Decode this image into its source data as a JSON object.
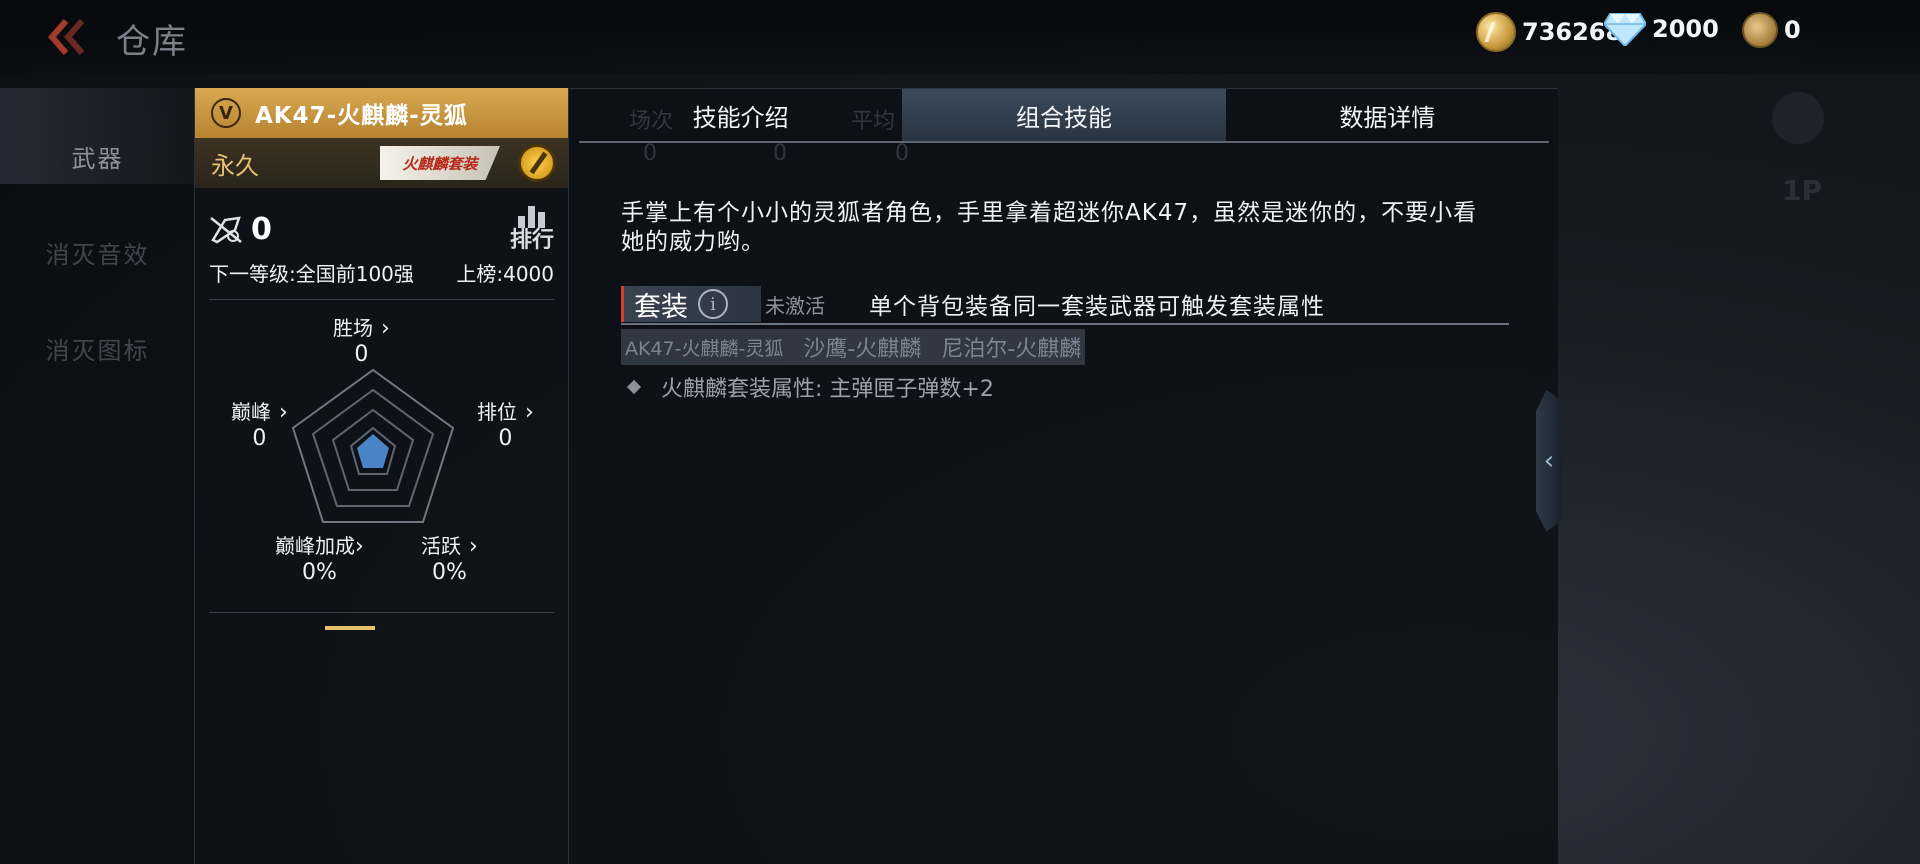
{
  "header": {
    "title": "仓库",
    "currencies": [
      {
        "name": "gold-coin",
        "value": "736268"
      },
      {
        "name": "diamond",
        "value": "2000"
      },
      {
        "name": "honor-coin",
        "value": "0"
      }
    ]
  },
  "side_nav": {
    "items": [
      {
        "label": "武器",
        "active": true
      },
      {
        "label": "消灭音效",
        "active": false
      },
      {
        "label": "消灭图标",
        "active": false
      }
    ]
  },
  "weapon": {
    "badge": "V",
    "name": "AK47-火麒麟-灵狐",
    "duration": "永久",
    "suit_badge": "火麒麟套装",
    "kills": "0",
    "rank_button": "排行",
    "next_level": "下一等级:全国前100强",
    "leaderboard": "上榜:4000"
  },
  "radar": {
    "labels": [
      {
        "name": "胜场",
        "value": "0"
      },
      {
        "name": "排位",
        "value": "0"
      },
      {
        "name": "活跃",
        "value": "0%"
      },
      {
        "name": "巅峰加成",
        "value": "0%"
      },
      {
        "name": "巅峰",
        "value": "0"
      }
    ],
    "fill_color": "#4a83c6"
  },
  "tabs": [
    {
      "label": "技能介绍",
      "active": false
    },
    {
      "label": "组合技能",
      "active": true
    },
    {
      "label": "数据详情",
      "active": false
    }
  ],
  "ghost_stats": {
    "labels": [
      "场次",
      "平均"
    ],
    "values": [
      "0",
      "0",
      "0"
    ]
  },
  "skill": {
    "description": "手掌上有个小小的灵狐者角色，手里拿着超迷你AK47，虽然是迷你的，不要小看她的威力哟。",
    "suit_title": "套装",
    "info_icon": "i",
    "suit_status": "未激活",
    "suit_note": "单个背包装备同一套装武器可触发套装属性",
    "suit_items": [
      "AK47-火麒麟-灵狐",
      "沙鹰-火麒麟",
      "尼泊尔-火麒麟"
    ],
    "attribute": "火麒麟套装属性: 主弹匣子弹数+2"
  },
  "right_ghost": {
    "badge": "1P"
  }
}
